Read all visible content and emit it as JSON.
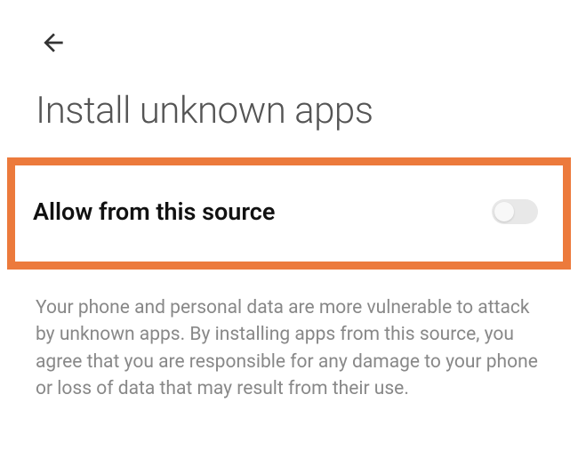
{
  "header": {
    "title": "Install unknown apps"
  },
  "setting": {
    "toggle_label": "Allow from this source",
    "toggle_state": "off"
  },
  "warning": {
    "text": "Your phone and personal data are more vulnerable to attack by unknown apps. By installing apps from this source, you agree that you are responsible for any damage to your phone or loss of data that may result from their use."
  },
  "colors": {
    "highlight_border": "#ec7a3c",
    "title_color": "#555",
    "label_color": "#111",
    "warning_color": "#888"
  }
}
